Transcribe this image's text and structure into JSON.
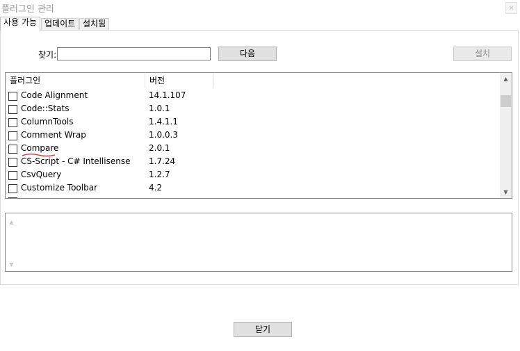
{
  "window": {
    "title": "플러그인 관리",
    "close_label": "×"
  },
  "tabs": [
    {
      "label": "사용 가능"
    },
    {
      "label": "업데이트"
    },
    {
      "label": "설치됨"
    }
  ],
  "search": {
    "label": "찾기:",
    "value": ""
  },
  "buttons": {
    "next": "다음",
    "install": "설치",
    "close": "닫기"
  },
  "table": {
    "headers": [
      "플러그인",
      "버전"
    ],
    "rows": [
      {
        "name": "Code Alignment",
        "version": "14.1.107"
      },
      {
        "name": "Code::Stats",
        "version": "1.0.1"
      },
      {
        "name": "ColumnTools",
        "version": "1.4.1.1"
      },
      {
        "name": "Comment Wrap",
        "version": "1.0.0.3"
      },
      {
        "name": "Compare",
        "version": "2.0.1"
      },
      {
        "name": "CS-Script - C# Intellisense",
        "version": "1.7.24"
      },
      {
        "name": "CsvQuery",
        "version": "1.2.7"
      },
      {
        "name": "Customize Toolbar",
        "version": "4.2"
      }
    ]
  },
  "icons": {
    "scroll_up": "▲",
    "scroll_down": "▼"
  },
  "annotation_color": "#e03030"
}
